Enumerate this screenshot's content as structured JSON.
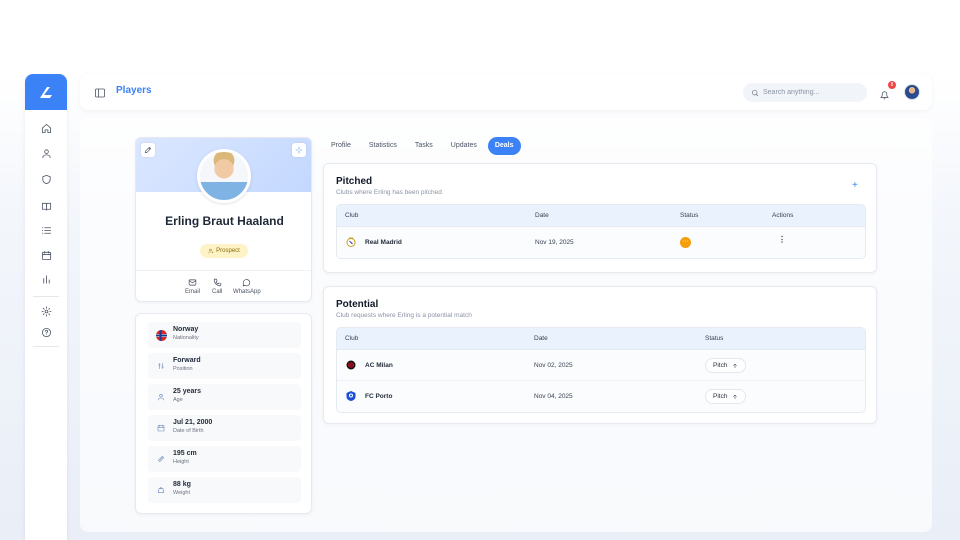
{
  "topbar": {
    "page_title": "Players",
    "search_placeholder": "Search anything...",
    "notification_count": "8"
  },
  "sidebar": {
    "items": [
      {
        "icon": "home-icon"
      },
      {
        "icon": "user-icon"
      },
      {
        "icon": "shield-icon"
      },
      {
        "icon": "book-icon"
      },
      {
        "icon": "list-icon"
      },
      {
        "icon": "calendar-icon"
      },
      {
        "icon": "chart-icon"
      },
      {
        "icon": "settings-icon"
      },
      {
        "icon": "help-icon"
      }
    ]
  },
  "profile": {
    "name": "Erling Braut Haaland",
    "badge": "Prospect",
    "contacts": [
      {
        "label": "Email"
      },
      {
        "label": "Call"
      },
      {
        "label": "WhatsApp"
      }
    ]
  },
  "info": [
    {
      "value": "Norway",
      "label": "Nationality"
    },
    {
      "value": "Forward",
      "label": "Position"
    },
    {
      "value": "25 years",
      "label": "Age"
    },
    {
      "value": "Jul 21, 2000",
      "label": "Date of Birth"
    },
    {
      "value": "195 cm",
      "label": "Height"
    },
    {
      "value": "88 kg",
      "label": "Weight"
    }
  ],
  "tabs": [
    {
      "label": "Profile"
    },
    {
      "label": "Statistics"
    },
    {
      "label": "Tasks"
    },
    {
      "label": "Updates"
    },
    {
      "label": "Deals",
      "active": true
    }
  ],
  "pitched": {
    "title": "Pitched",
    "subtitle": "Clubs where Erling has been pitched",
    "add": "+",
    "columns": [
      "Club",
      "Date",
      "Status",
      "Actions"
    ],
    "rows": [
      {
        "club": "Real Madrid",
        "date": "Nov 19, 2025",
        "status_color": "#f59e0b",
        "status_glyph": "···"
      }
    ]
  },
  "potential": {
    "title": "Potential",
    "subtitle": "Club requests where Erling is a potential match",
    "columns": [
      "Club",
      "Date",
      "Status"
    ],
    "rows": [
      {
        "club": "AC Milan",
        "date": "Nov 02, 2025",
        "action": "Pitch"
      },
      {
        "club": "FC Porto",
        "date": "Nov 04, 2025",
        "action": "Pitch"
      }
    ]
  },
  "colors": {
    "accent": "#3b82f6",
    "prospect_bg": "#fdf3c7",
    "pending": "#f59e0b"
  }
}
